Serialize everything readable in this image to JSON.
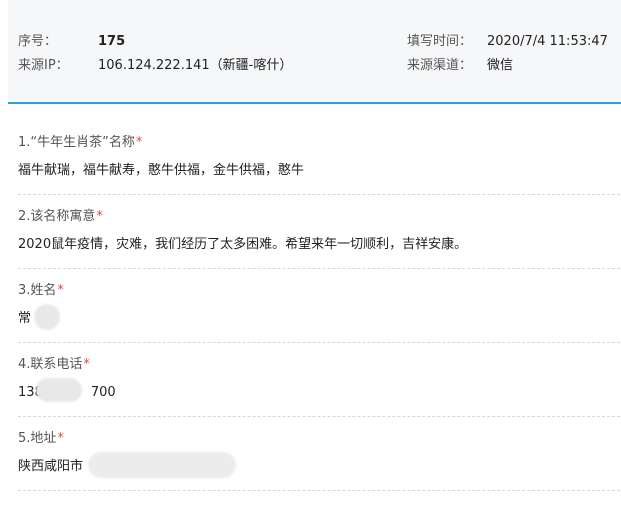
{
  "header": {
    "seq_label": "序号：",
    "seq_value": "175",
    "ip_label": "来源IP：",
    "ip_value": "106.124.222.141（新疆-喀什）",
    "time_label": "填写时间：",
    "time_value": "2020/7/4 11:53:47",
    "channel_label": "来源渠道：",
    "channel_value": "微信",
    "accent_color": "#2ea2d8"
  },
  "questions": [
    {
      "title": "1.“牛年生肖茶”名称",
      "required": "*",
      "answer": "福牛献瑞，福牛献寿，憨牛供福，金牛供福，憨牛"
    },
    {
      "title": "2.该名称寓意",
      "required": "*",
      "answer": "2020鼠年疫情，灾难，我们经历了太多困难。希望来年一切顺利，吉祥安康。"
    },
    {
      "title": "3.姓名",
      "required": "*",
      "answer": "常"
    },
    {
      "title": "4.联系电话",
      "required": "*",
      "answer_prefix": "138",
      "answer_suffix": "700"
    },
    {
      "title": "5.地址",
      "required": "*",
      "answer": "陕西咸阳市"
    }
  ]
}
